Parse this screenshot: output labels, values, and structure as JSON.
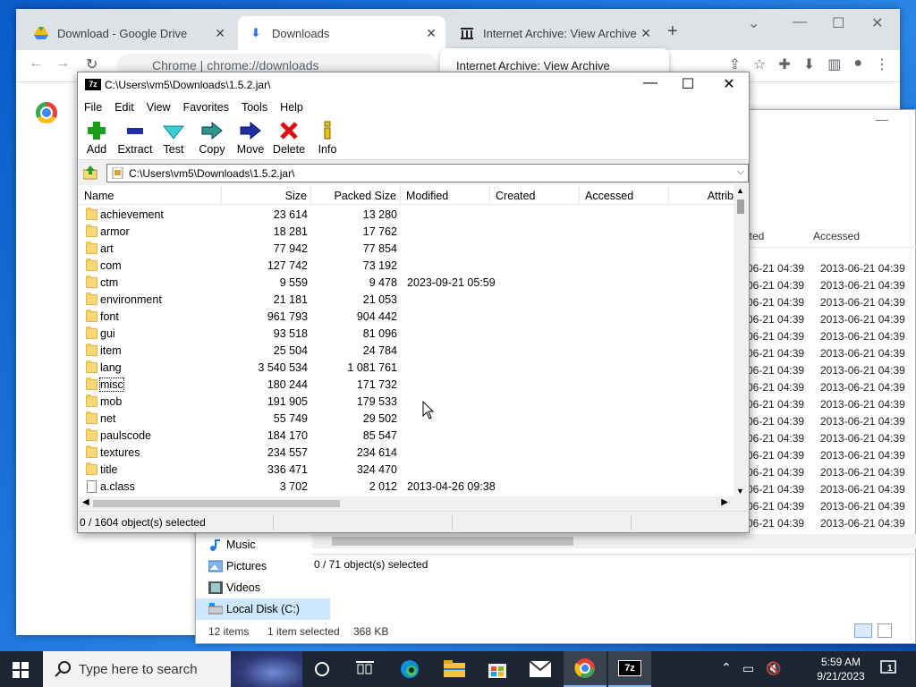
{
  "chrome": {
    "tabs": [
      {
        "title": "Download - Google Drive",
        "icon": "google-drive-icon"
      },
      {
        "title": "Downloads",
        "icon": "download-icon"
      },
      {
        "title": "Internet Archive: View Archive",
        "icon": "archive-icon"
      }
    ],
    "omnibox": "Chrome  |  chrome://downloads",
    "tab_tooltip": "Internet Archive: View Archive"
  },
  "explorer": {
    "header": {
      "created": "ated",
      "accessed": "Accessed"
    },
    "rows": [
      {
        "created": "-06-21 04:39",
        "accessed": "2013-06-21 04:39"
      },
      {
        "created": "-06-21 04:39",
        "accessed": "2013-06-21 04:39"
      },
      {
        "created": "-06-21 04:39",
        "accessed": "2013-06-21 04:39"
      },
      {
        "created": "-06-21 04:39",
        "accessed": "2013-06-21 04:39"
      },
      {
        "created": "-06-21 04:39",
        "accessed": "2013-06-21 04:39"
      },
      {
        "created": "-06-21 04:39",
        "accessed": "2013-06-21 04:39"
      },
      {
        "created": "-06-21 04:39",
        "accessed": "2013-06-21 04:39"
      },
      {
        "created": "-06-21 04:39",
        "accessed": "2013-06-21 04:39"
      },
      {
        "created": "-06-21 04:39",
        "accessed": "2013-06-21 04:39"
      },
      {
        "created": "-06-21 04:39",
        "accessed": "2013-06-21 04:39"
      },
      {
        "created": "-06-21 04:39",
        "accessed": "2013-06-21 04:39"
      },
      {
        "created": "-06-21 04:39",
        "accessed": "2013-06-21 04:39"
      },
      {
        "created": "-06-21 04:39",
        "accessed": "2013-06-21 04:39"
      },
      {
        "created": "-06-21 04:39",
        "accessed": "2013-06-21 04:39"
      },
      {
        "created": "-06-21 04:39",
        "accessed": "2013-06-21 04:39"
      },
      {
        "created": "-06-21 04:39",
        "accessed": "2013-06-21 04:39"
      },
      {
        "created": "-06-21 04:39",
        "accessed": "2013-06-21 04:39"
      }
    ],
    "nav": [
      "Music",
      "Pictures",
      "Videos",
      "Local Disk (C:)"
    ],
    "inner_status": "0 / 71 object(s) selected",
    "status": {
      "items": "12 items",
      "selected": "1 item selected",
      "size": "368 KB"
    }
  },
  "sevenzip": {
    "title": "C:\\Users\\vm5\\Downloads\\1.5.2.jar\\",
    "menu": [
      "File",
      "Edit",
      "View",
      "Favorites",
      "Tools",
      "Help"
    ],
    "toolbar": [
      "Add",
      "Extract",
      "Test",
      "Copy",
      "Move",
      "Delete",
      "Info"
    ],
    "address": "C:\\Users\\vm5\\Downloads\\1.5.2.jar\\",
    "columns": [
      "Name",
      "Size",
      "Packed Size",
      "Modified",
      "Created",
      "Accessed",
      "Attrib"
    ],
    "rows": [
      {
        "name": "achievement",
        "size": "23 614",
        "packed": "13 280",
        "modified": "",
        "type": "folder"
      },
      {
        "name": "armor",
        "size": "18 281",
        "packed": "17 762",
        "modified": "",
        "type": "folder"
      },
      {
        "name": "art",
        "size": "77 942",
        "packed": "77 854",
        "modified": "",
        "type": "folder"
      },
      {
        "name": "com",
        "size": "127 742",
        "packed": "73 192",
        "modified": "",
        "type": "folder"
      },
      {
        "name": "ctm",
        "size": "9 559",
        "packed": "9 478",
        "modified": "2023-09-21 05:59",
        "type": "folder"
      },
      {
        "name": "environment",
        "size": "21 181",
        "packed": "21 053",
        "modified": "",
        "type": "folder"
      },
      {
        "name": "font",
        "size": "961 793",
        "packed": "904 442",
        "modified": "",
        "type": "folder"
      },
      {
        "name": "gui",
        "size": "93 518",
        "packed": "81 096",
        "modified": "",
        "type": "folder"
      },
      {
        "name": "item",
        "size": "25 504",
        "packed": "24 784",
        "modified": "",
        "type": "folder"
      },
      {
        "name": "lang",
        "size": "3 540 534",
        "packed": "1 081 761",
        "modified": "",
        "type": "folder"
      },
      {
        "name": "misc",
        "size": "180 244",
        "packed": "171 732",
        "modified": "",
        "type": "folder",
        "focused": true
      },
      {
        "name": "mob",
        "size": "191 905",
        "packed": "179 533",
        "modified": "",
        "type": "folder"
      },
      {
        "name": "net",
        "size": "55 749",
        "packed": "29 502",
        "modified": "",
        "type": "folder"
      },
      {
        "name": "paulscode",
        "size": "184 170",
        "packed": "85 547",
        "modified": "",
        "type": "folder"
      },
      {
        "name": "textures",
        "size": "234 557",
        "packed": "234 614",
        "modified": "",
        "type": "folder"
      },
      {
        "name": "title",
        "size": "336 471",
        "packed": "324 470",
        "modified": "",
        "type": "folder"
      },
      {
        "name": "a.class",
        "size": "3 702",
        "packed": "2 012",
        "modified": "2013-04-26 09:38",
        "type": "file"
      }
    ],
    "status": "0 / 1604 object(s) selected"
  },
  "taskbar": {
    "search_placeholder": "Type here to search",
    "time": "5:59 AM",
    "date": "9/21/2023",
    "notifications": "1"
  }
}
